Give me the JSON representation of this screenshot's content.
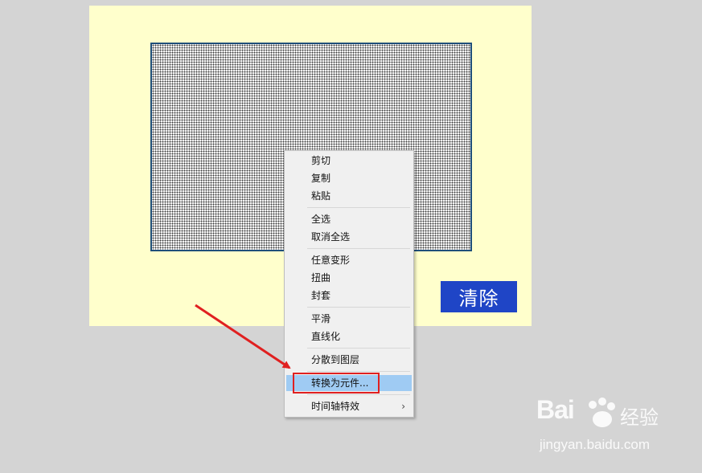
{
  "stage": {
    "background": "#ffffcc",
    "clear_button_label": "清除",
    "clear_button_color": "#1f45c6"
  },
  "context_menu": {
    "items": [
      {
        "label": "剪切"
      },
      {
        "label": "复制"
      },
      {
        "label": "粘贴"
      },
      {
        "label": "全选"
      },
      {
        "label": "取消全选"
      },
      {
        "label": "任意变形"
      },
      {
        "label": "扭曲"
      },
      {
        "label": "封套"
      },
      {
        "label": "平滑"
      },
      {
        "label": "直线化"
      },
      {
        "label": "分散到图层"
      },
      {
        "label": "转换为元件..."
      },
      {
        "label": "时间轴特效"
      }
    ],
    "highlighted_item": "转换为元件...",
    "submenu_icon": "chevron-right-icon"
  },
  "annotation": {
    "arrow_color": "#e02020",
    "box_color": "#e02020"
  },
  "watermark": {
    "logo_text": "Bai",
    "product": "经验",
    "url": "jingyan.baidu.com"
  }
}
